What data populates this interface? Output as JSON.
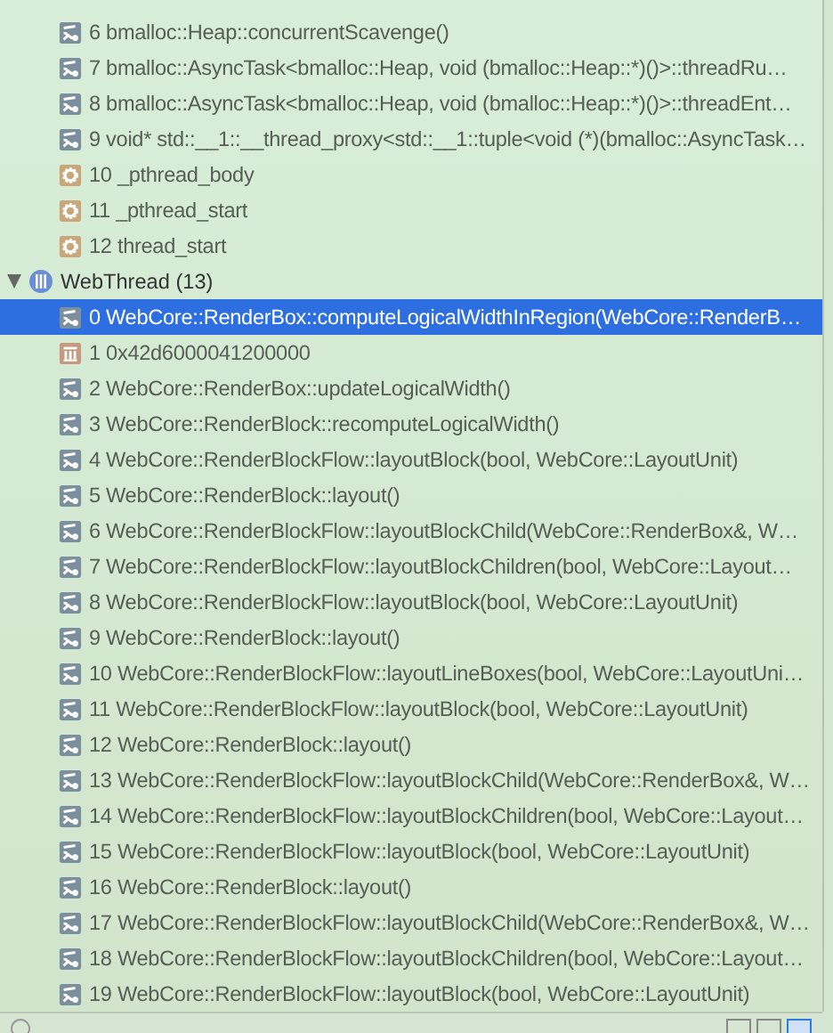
{
  "frames": [
    {
      "label": "6 bmalloc::Heap::concurrentScavenge()",
      "kind": "source",
      "selected": false
    },
    {
      "label": "7 bmalloc::AsyncTask<bmalloc::Heap, void (bmalloc::Heap::*)()>::threadRu…",
      "kind": "source",
      "selected": false
    },
    {
      "label": "8 bmalloc::AsyncTask<bmalloc::Heap, void (bmalloc::Heap::*)()>::threadEnt…",
      "kind": "source",
      "selected": false
    },
    {
      "label": "9 void* std::__1::__thread_proxy<std::__1::tuple<void (*)(bmalloc::AsyncTask…",
      "kind": "source",
      "selected": false
    },
    {
      "label": "10 _pthread_body",
      "kind": "system",
      "selected": false
    },
    {
      "label": "11 _pthread_start",
      "kind": "system",
      "selected": false
    },
    {
      "label": "12 thread_start",
      "kind": "system",
      "selected": false
    }
  ],
  "threads": [
    {
      "name": "WebThread (13)",
      "expanded": true,
      "frames": [
        {
          "label": "0 WebCore::RenderBox::computeLogicalWidthInRegion(WebCore::RenderB…",
          "kind": "source",
          "selected": true
        },
        {
          "label": "1 0x42d6000041200000",
          "kind": "address",
          "selected": false
        },
        {
          "label": "2 WebCore::RenderBox::updateLogicalWidth()",
          "kind": "source",
          "selected": false
        },
        {
          "label": "3 WebCore::RenderBlock::recomputeLogicalWidth()",
          "kind": "source",
          "selected": false
        },
        {
          "label": "4 WebCore::RenderBlockFlow::layoutBlock(bool, WebCore::LayoutUnit)",
          "kind": "source",
          "selected": false
        },
        {
          "label": "5 WebCore::RenderBlock::layout()",
          "kind": "source",
          "selected": false
        },
        {
          "label": "6 WebCore::RenderBlockFlow::layoutBlockChild(WebCore::RenderBox&, W…",
          "kind": "source",
          "selected": false
        },
        {
          "label": "7 WebCore::RenderBlockFlow::layoutBlockChildren(bool, WebCore::Layout…",
          "kind": "source",
          "selected": false
        },
        {
          "label": "8 WebCore::RenderBlockFlow::layoutBlock(bool, WebCore::LayoutUnit)",
          "kind": "source",
          "selected": false
        },
        {
          "label": "9 WebCore::RenderBlock::layout()",
          "kind": "source",
          "selected": false
        },
        {
          "label": "10 WebCore::RenderBlockFlow::layoutLineBoxes(bool, WebCore::LayoutUni…",
          "kind": "source",
          "selected": false
        },
        {
          "label": "11 WebCore::RenderBlockFlow::layoutBlock(bool, WebCore::LayoutUnit)",
          "kind": "source",
          "selected": false
        },
        {
          "label": "12 WebCore::RenderBlock::layout()",
          "kind": "source",
          "selected": false
        },
        {
          "label": "13 WebCore::RenderBlockFlow::layoutBlockChild(WebCore::RenderBox&, W…",
          "kind": "source",
          "selected": false
        },
        {
          "label": "14 WebCore::RenderBlockFlow::layoutBlockChildren(bool, WebCore::Layout…",
          "kind": "source",
          "selected": false
        },
        {
          "label": "15 WebCore::RenderBlockFlow::layoutBlock(bool, WebCore::LayoutUnit)",
          "kind": "source",
          "selected": false
        },
        {
          "label": "16 WebCore::RenderBlock::layout()",
          "kind": "source",
          "selected": false
        },
        {
          "label": "17 WebCore::RenderBlockFlow::layoutBlockChild(WebCore::RenderBox&, W…",
          "kind": "source",
          "selected": false
        },
        {
          "label": "18 WebCore::RenderBlockFlow::layoutBlockChildren(bool, WebCore::Layout…",
          "kind": "source",
          "selected": false
        },
        {
          "label": "19 WebCore::RenderBlockFlow::layoutBlock(bool, WebCore::LayoutUnit)",
          "kind": "source",
          "selected": false
        }
      ]
    }
  ],
  "filter_buttons": [
    {
      "selected": false
    },
    {
      "selected": false
    },
    {
      "selected": true
    }
  ]
}
